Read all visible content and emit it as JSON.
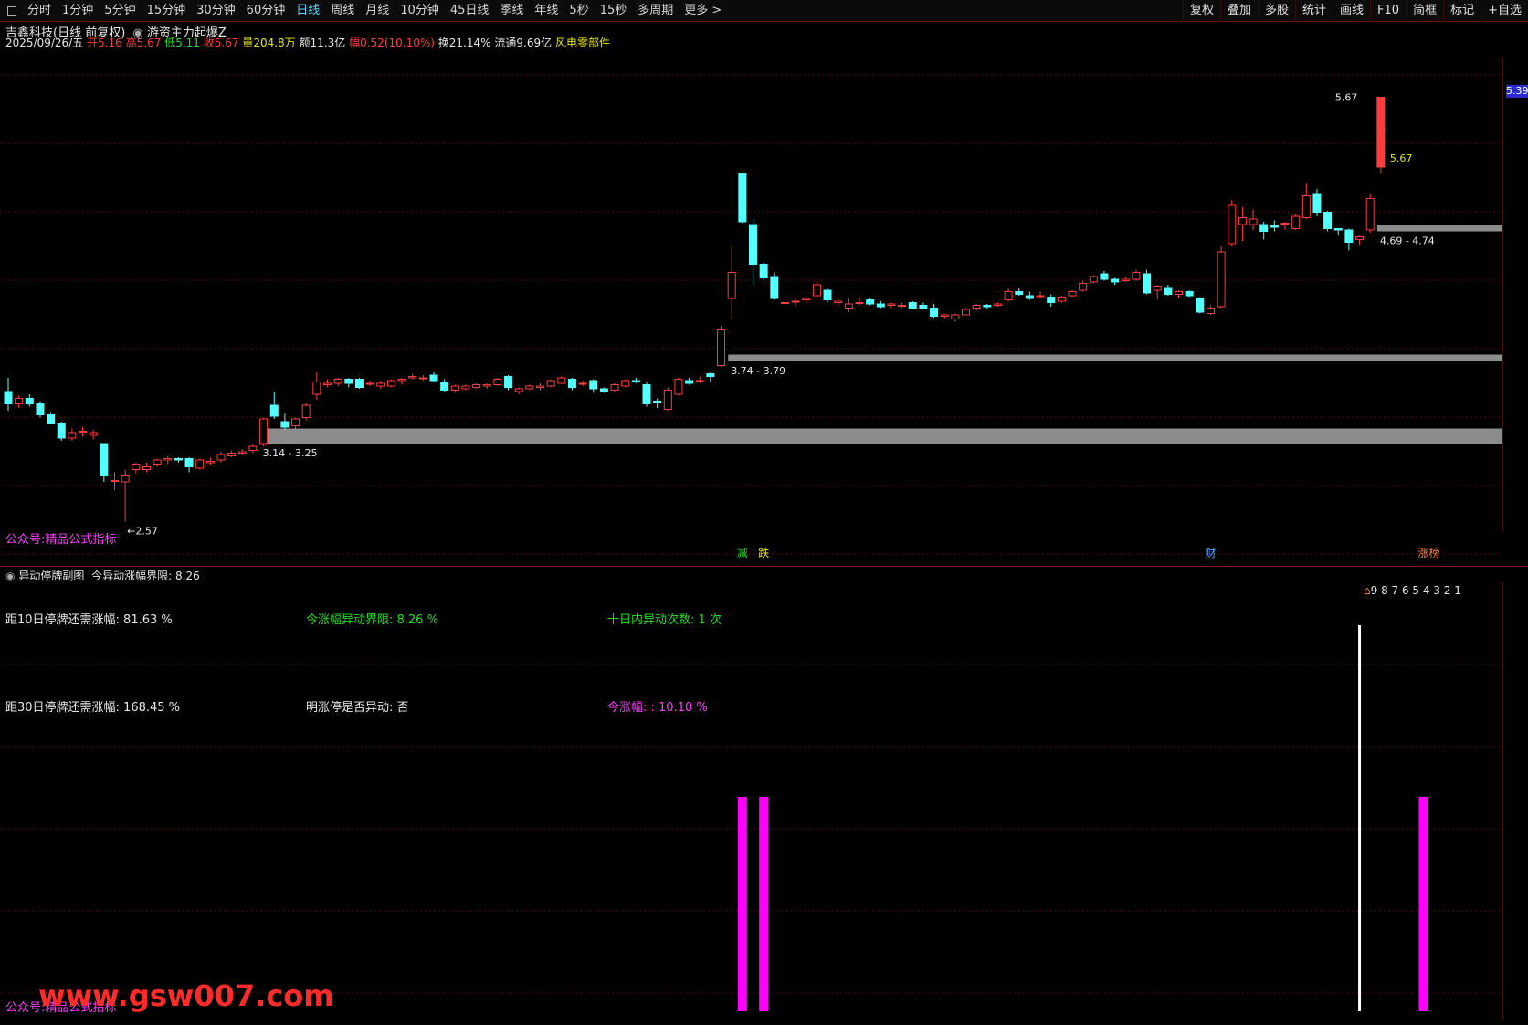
{
  "toolbar": {
    "periods": [
      "分时",
      "1分钟",
      "5分钟",
      "15分钟",
      "30分钟",
      "60分钟",
      "日线",
      "周线",
      "月线",
      "10分钟",
      "45日线",
      "季线",
      "年线",
      "5秒",
      "15秒",
      "多周期",
      "更多 >"
    ],
    "active_period": "日线",
    "right_tools": [
      "复权",
      "叠加",
      "多股",
      "统计",
      "画线",
      "F10",
      "简框",
      "标记",
      "+自选"
    ]
  },
  "title": {
    "stock": "吉鑫科技(日线 前复权)",
    "indicator": "游资主力起爆Z"
  },
  "quote": {
    "date": "2025/09/26/五",
    "open_label": "开",
    "open": "5.16",
    "high_label": "高",
    "high": "5.67",
    "low_label": "低",
    "low": "5.11",
    "close_label": "收",
    "close": "5.67",
    "vol_label": "量",
    "vol": "204.8万",
    "amt_label": "额",
    "amt": "11.3亿",
    "chg_label": "幅",
    "chg": "0.52(10.10%)",
    "turn_label": "换",
    "turn": "21.14%",
    "float_label": "流通",
    "float": "9.69亿",
    "concept": "风电零部件"
  },
  "main_labels": {
    "price_high": "5.67",
    "price_close": "5.67",
    "price_low": "2.57",
    "axis_tag": "5.39",
    "zone1": "3.14 - 3.25",
    "zone2": "3.74 - 3.79",
    "zone3": "4.69 - 4.74",
    "public": "公众号:精品公式指标",
    "marker_a": "减",
    "marker_b": "跌",
    "marker_c": "财",
    "marker_d": "涨榜"
  },
  "sub": {
    "title": "异动停牌副图",
    "limit_text": "今异动涨幅界限: 8.26",
    "countdown": "9 8 7 6 5 4 3 2 1",
    "r1c1": "距10日停牌还需涨幅: 81.63 %",
    "r1c2": "今涨幅异动界限: 8.26 %",
    "r1c3": "十日内异动次数: 1 次",
    "r2c1": "距30日停牌还需涨幅: 168.45 %",
    "r2c2": "明涨停是否异动: 否",
    "r2c3": "今涨幅: : 10.10 %",
    "public": "公众号:精品公式指标",
    "watermark": "www.gsw007.com"
  },
  "colors": {
    "up": "#ff3c3c",
    "down": "#54ffff",
    "zone": "#8c8c8c",
    "grid": "#5a0a0a",
    "magenta": "#ff00ff",
    "green": "#22dd22"
  },
  "chart_data": {
    "type": "candlestick",
    "ylim": [
      2.5,
      5.9
    ],
    "candles": [
      {
        "o": 3.52,
        "h": 3.62,
        "l": 3.38,
        "c": 3.43
      },
      {
        "o": 3.43,
        "h": 3.49,
        "l": 3.4,
        "c": 3.47
      },
      {
        "o": 3.47,
        "h": 3.5,
        "l": 3.41,
        "c": 3.43
      },
      {
        "o": 3.43,
        "h": 3.45,
        "l": 3.33,
        "c": 3.35
      },
      {
        "o": 3.35,
        "h": 3.37,
        "l": 3.28,
        "c": 3.29
      },
      {
        "o": 3.29,
        "h": 3.3,
        "l": 3.16,
        "c": 3.18
      },
      {
        "o": 3.18,
        "h": 3.25,
        "l": 3.16,
        "c": 3.22
      },
      {
        "o": 3.23,
        "h": 3.26,
        "l": 3.19,
        "c": 3.23
      },
      {
        "o": 3.2,
        "h": 3.24,
        "l": 3.17,
        "c": 3.22
      },
      {
        "o": 3.14,
        "h": 3.14,
        "l": 2.86,
        "c": 2.91
      },
      {
        "o": 2.87,
        "h": 2.93,
        "l": 2.8,
        "c": 2.87
      },
      {
        "o": 2.86,
        "h": 2.95,
        "l": 2.57,
        "c": 2.91
      },
      {
        "o": 2.95,
        "h": 3.0,
        "l": 2.92,
        "c": 2.99
      },
      {
        "o": 2.95,
        "h": 3.0,
        "l": 2.93,
        "c": 2.97
      },
      {
        "o": 2.99,
        "h": 3.03,
        "l": 2.97,
        "c": 3.02
      },
      {
        "o": 3.02,
        "h": 3.05,
        "l": 2.99,
        "c": 3.03
      },
      {
        "o": 3.03,
        "h": 3.04,
        "l": 3.0,
        "c": 3.02
      },
      {
        "o": 3.03,
        "h": 3.04,
        "l": 2.93,
        "c": 2.97
      },
      {
        "o": 2.96,
        "h": 3.03,
        "l": 2.95,
        "c": 3.02
      },
      {
        "o": 3.0,
        "h": 3.04,
        "l": 2.98,
        "c": 3.01
      },
      {
        "o": 3.02,
        "h": 3.08,
        "l": 3.0,
        "c": 3.06
      },
      {
        "o": 3.05,
        "h": 3.09,
        "l": 3.04,
        "c": 3.07
      },
      {
        "o": 3.07,
        "h": 3.1,
        "l": 3.06,
        "c": 3.08
      },
      {
        "o": 3.09,
        "h": 3.14,
        "l": 3.07,
        "c": 3.12
      },
      {
        "o": 3.14,
        "h": 3.33,
        "l": 3.12,
        "c": 3.32
      },
      {
        "o": 3.42,
        "h": 3.52,
        "l": 3.32,
        "c": 3.34
      },
      {
        "o": 3.3,
        "h": 3.36,
        "l": 3.24,
        "c": 3.26
      },
      {
        "o": 3.27,
        "h": 3.33,
        "l": 3.25,
        "c": 3.32
      },
      {
        "o": 3.33,
        "h": 3.44,
        "l": 3.31,
        "c": 3.42
      },
      {
        "o": 3.5,
        "h": 3.66,
        "l": 3.46,
        "c": 3.59
      },
      {
        "o": 3.57,
        "h": 3.61,
        "l": 3.55,
        "c": 3.58
      },
      {
        "o": 3.58,
        "h": 3.62,
        "l": 3.56,
        "c": 3.61
      },
      {
        "o": 3.61,
        "h": 3.62,
        "l": 3.55,
        "c": 3.58
      },
      {
        "o": 3.61,
        "h": 3.62,
        "l": 3.54,
        "c": 3.55
      },
      {
        "o": 3.58,
        "h": 3.6,
        "l": 3.56,
        "c": 3.58
      },
      {
        "o": 3.56,
        "h": 3.6,
        "l": 3.54,
        "c": 3.58
      },
      {
        "o": 3.56,
        "h": 3.61,
        "l": 3.55,
        "c": 3.6
      },
      {
        "o": 3.6,
        "h": 3.62,
        "l": 3.57,
        "c": 3.61
      },
      {
        "o": 3.62,
        "h": 3.65,
        "l": 3.61,
        "c": 3.63
      },
      {
        "o": 3.62,
        "h": 3.64,
        "l": 3.6,
        "c": 3.62
      },
      {
        "o": 3.64,
        "h": 3.66,
        "l": 3.59,
        "c": 3.6
      },
      {
        "o": 3.59,
        "h": 3.61,
        "l": 3.52,
        "c": 3.53
      },
      {
        "o": 3.53,
        "h": 3.57,
        "l": 3.51,
        "c": 3.56
      },
      {
        "o": 3.54,
        "h": 3.57,
        "l": 3.53,
        "c": 3.56
      },
      {
        "o": 3.55,
        "h": 3.58,
        "l": 3.54,
        "c": 3.57
      },
      {
        "o": 3.56,
        "h": 3.58,
        "l": 3.54,
        "c": 3.57
      },
      {
        "o": 3.57,
        "h": 3.62,
        "l": 3.56,
        "c": 3.61
      },
      {
        "o": 3.63,
        "h": 3.64,
        "l": 3.53,
        "c": 3.55
      },
      {
        "o": 3.52,
        "h": 3.55,
        "l": 3.5,
        "c": 3.54
      },
      {
        "o": 3.54,
        "h": 3.57,
        "l": 3.53,
        "c": 3.56
      },
      {
        "o": 3.55,
        "h": 3.58,
        "l": 3.53,
        "c": 3.56
      },
      {
        "o": 3.56,
        "h": 3.61,
        "l": 3.55,
        "c": 3.6
      },
      {
        "o": 3.58,
        "h": 3.63,
        "l": 3.58,
        "c": 3.62
      },
      {
        "o": 3.61,
        "h": 3.62,
        "l": 3.53,
        "c": 3.55
      },
      {
        "o": 3.58,
        "h": 3.6,
        "l": 3.56,
        "c": 3.58
      },
      {
        "o": 3.6,
        "h": 3.61,
        "l": 3.51,
        "c": 3.54
      },
      {
        "o": 3.54,
        "h": 3.55,
        "l": 3.51,
        "c": 3.52
      },
      {
        "o": 3.53,
        "h": 3.58,
        "l": 3.52,
        "c": 3.57
      },
      {
        "o": 3.56,
        "h": 3.61,
        "l": 3.55,
        "c": 3.6
      },
      {
        "o": 3.6,
        "h": 3.62,
        "l": 3.58,
        "c": 3.59
      },
      {
        "o": 3.57,
        "h": 3.59,
        "l": 3.41,
        "c": 3.43
      },
      {
        "o": 3.45,
        "h": 3.47,
        "l": 3.4,
        "c": 3.44
      },
      {
        "o": 3.39,
        "h": 3.55,
        "l": 3.38,
        "c": 3.53
      },
      {
        "o": 3.5,
        "h": 3.62,
        "l": 3.49,
        "c": 3.61
      },
      {
        "o": 3.6,
        "h": 3.62,
        "l": 3.57,
        "c": 3.58
      },
      {
        "o": 3.6,
        "h": 3.63,
        "l": 3.58,
        "c": 3.6
      },
      {
        "o": 3.65,
        "h": 3.66,
        "l": 3.59,
        "c": 3.63
      },
      {
        "o": 3.71,
        "h": 4.0,
        "l": 3.7,
        "c": 3.97
      },
      {
        "o": 4.2,
        "h": 4.59,
        "l": 4.05,
        "c": 4.39
      },
      {
        "o": 5.11,
        "h": 5.11,
        "l": 4.75,
        "c": 4.76
      },
      {
        "o": 4.74,
        "h": 4.78,
        "l": 4.29,
        "c": 4.45
      },
      {
        "o": 4.45,
        "h": 4.46,
        "l": 4.33,
        "c": 4.35
      },
      {
        "o": 4.36,
        "h": 4.39,
        "l": 4.19,
        "c": 4.2
      },
      {
        "o": 4.17,
        "h": 4.2,
        "l": 4.14,
        "c": 4.17
      },
      {
        "o": 4.18,
        "h": 4.21,
        "l": 4.14,
        "c": 4.18
      },
      {
        "o": 4.19,
        "h": 4.21,
        "l": 4.17,
        "c": 4.2
      },
      {
        "o": 4.22,
        "h": 4.33,
        "l": 4.21,
        "c": 4.3
      },
      {
        "o": 4.26,
        "h": 4.27,
        "l": 4.17,
        "c": 4.19
      },
      {
        "o": 4.17,
        "h": 4.2,
        "l": 4.13,
        "c": 4.18
      },
      {
        "o": 4.13,
        "h": 4.2,
        "l": 4.1,
        "c": 4.16
      },
      {
        "o": 4.17,
        "h": 4.21,
        "l": 4.15,
        "c": 4.17
      },
      {
        "o": 4.19,
        "h": 4.2,
        "l": 4.15,
        "c": 4.16
      },
      {
        "o": 4.16,
        "h": 4.18,
        "l": 4.13,
        "c": 4.14
      },
      {
        "o": 4.15,
        "h": 4.17,
        "l": 4.13,
        "c": 4.16
      },
      {
        "o": 4.15,
        "h": 4.17,
        "l": 4.13,
        "c": 4.15
      },
      {
        "o": 4.17,
        "h": 4.18,
        "l": 4.12,
        "c": 4.13
      },
      {
        "o": 4.15,
        "h": 4.17,
        "l": 4.12,
        "c": 4.13
      },
      {
        "o": 4.13,
        "h": 4.16,
        "l": 4.06,
        "c": 4.07
      },
      {
        "o": 4.07,
        "h": 4.09,
        "l": 4.05,
        "c": 4.08
      },
      {
        "o": 4.05,
        "h": 4.09,
        "l": 4.03,
        "c": 4.08
      },
      {
        "o": 4.08,
        "h": 4.13,
        "l": 4.08,
        "c": 4.12
      },
      {
        "o": 4.13,
        "h": 4.16,
        "l": 4.11,
        "c": 4.15
      },
      {
        "o": 4.15,
        "h": 4.16,
        "l": 4.12,
        "c": 4.14
      },
      {
        "o": 4.15,
        "h": 4.17,
        "l": 4.14,
        "c": 4.16
      },
      {
        "o": 4.19,
        "h": 4.27,
        "l": 4.18,
        "c": 4.25
      },
      {
        "o": 4.25,
        "h": 4.28,
        "l": 4.22,
        "c": 4.23
      },
      {
        "o": 4.22,
        "h": 4.25,
        "l": 4.19,
        "c": 4.2
      },
      {
        "o": 4.22,
        "h": 4.25,
        "l": 4.2,
        "c": 4.22
      },
      {
        "o": 4.21,
        "h": 4.23,
        "l": 4.14,
        "c": 4.17
      },
      {
        "o": 4.18,
        "h": 4.22,
        "l": 4.17,
        "c": 4.21
      },
      {
        "o": 4.22,
        "h": 4.26,
        "l": 4.21,
        "c": 4.25
      },
      {
        "o": 4.26,
        "h": 4.33,
        "l": 4.25,
        "c": 4.31
      },
      {
        "o": 4.32,
        "h": 4.37,
        "l": 4.31,
        "c": 4.36
      },
      {
        "o": 4.38,
        "h": 4.4,
        "l": 4.33,
        "c": 4.34
      },
      {
        "o": 4.34,
        "h": 4.35,
        "l": 4.3,
        "c": 4.32
      },
      {
        "o": 4.33,
        "h": 4.36,
        "l": 4.32,
        "c": 4.34
      },
      {
        "o": 4.34,
        "h": 4.41,
        "l": 4.33,
        "c": 4.39
      },
      {
        "o": 4.38,
        "h": 4.41,
        "l": 4.23,
        "c": 4.24
      },
      {
        "o": 4.26,
        "h": 4.3,
        "l": 4.19,
        "c": 4.29
      },
      {
        "o": 4.28,
        "h": 4.3,
        "l": 4.22,
        "c": 4.23
      },
      {
        "o": 4.23,
        "h": 4.26,
        "l": 4.2,
        "c": 4.25
      },
      {
        "o": 4.25,
        "h": 4.26,
        "l": 4.21,
        "c": 4.22
      },
      {
        "o": 4.2,
        "h": 4.21,
        "l": 4.09,
        "c": 4.1
      },
      {
        "o": 4.09,
        "h": 4.15,
        "l": 4.08,
        "c": 4.13
      },
      {
        "o": 4.14,
        "h": 4.58,
        "l": 4.13,
        "c": 4.54
      },
      {
        "o": 4.6,
        "h": 4.92,
        "l": 4.58,
        "c": 4.88
      },
      {
        "o": 4.74,
        "h": 4.87,
        "l": 4.62,
        "c": 4.79
      },
      {
        "o": 4.74,
        "h": 4.85,
        "l": 4.7,
        "c": 4.78
      },
      {
        "o": 4.74,
        "h": 4.76,
        "l": 4.63,
        "c": 4.69
      },
      {
        "o": 4.73,
        "h": 4.77,
        "l": 4.69,
        "c": 4.72
      },
      {
        "o": 4.75,
        "h": 4.76,
        "l": 4.7,
        "c": 4.75
      },
      {
        "o": 4.71,
        "h": 4.82,
        "l": 4.7,
        "c": 4.8
      },
      {
        "o": 4.79,
        "h": 5.04,
        "l": 4.78,
        "c": 4.95
      },
      {
        "o": 4.96,
        "h": 5.0,
        "l": 4.8,
        "c": 4.83
      },
      {
        "o": 4.83,
        "h": 4.84,
        "l": 4.69,
        "c": 4.71
      },
      {
        "o": 4.71,
        "h": 4.71,
        "l": 4.66,
        "c": 4.7
      },
      {
        "o": 4.7,
        "h": 4.71,
        "l": 4.55,
        "c": 4.61
      },
      {
        "o": 4.63,
        "h": 4.66,
        "l": 4.59,
        "c": 4.65
      },
      {
        "o": 4.7,
        "h": 4.96,
        "l": 4.68,
        "c": 4.93
      },
      {
        "o": 5.16,
        "h": 5.67,
        "l": 5.11,
        "c": 5.67
      }
    ],
    "zones": [
      {
        "label": "3.14 - 3.25",
        "from_index": 24,
        "lo": 3.14,
        "hi": 3.25
      },
      {
        "label": "3.74 - 3.79",
        "from_index": 68,
        "lo": 3.74,
        "hi": 3.79
      },
      {
        "label": "4.69 - 4.74",
        "from_index": 129,
        "lo": 4.69,
        "hi": 4.74
      }
    ],
    "sub_bars": [
      {
        "index": 69,
        "value": 1.0,
        "color": "magenta"
      },
      {
        "index": 71,
        "value": 1.0,
        "color": "magenta"
      },
      {
        "index": 127,
        "value": 1.8,
        "color": "white"
      },
      {
        "index": 133,
        "value": 1.0,
        "color": "magenta"
      }
    ]
  }
}
